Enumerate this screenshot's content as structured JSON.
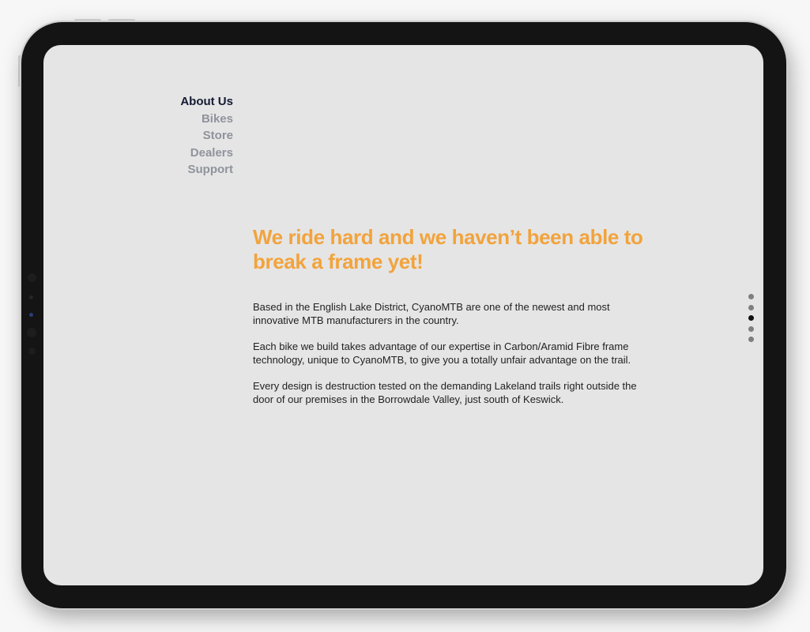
{
  "nav": {
    "items": [
      {
        "label": "About Us",
        "active": true
      },
      {
        "label": "Bikes",
        "active": false
      },
      {
        "label": "Store",
        "active": false
      },
      {
        "label": "Dealers",
        "active": false
      },
      {
        "label": "Support",
        "active": false
      }
    ]
  },
  "main": {
    "headline": "We ride hard and we haven’t been able to break a frame yet!",
    "paragraphs": [
      "Based in the English Lake District, CyanoMTB are one of the newest and most innovative MTB manufacturers in the country.",
      "Each bike we build takes advantage of our expertise in Carbon/Aramid Fibre frame technology, unique to CyanoMTB, to give you a totally unfair advantage on the trail.",
      "Every design is destruction tested on the demanding Lakeland trails right outside the door of our premises in the Borrowdale Valley, just south of Keswick."
    ]
  },
  "pager": {
    "count": 5,
    "active_index": 2
  },
  "colors": {
    "accent": "#f2a33c",
    "nav_active": "#141a33",
    "nav_inactive": "#8f939c",
    "screen_bg": "#e5e5e5",
    "device_bezel": "#141414"
  }
}
